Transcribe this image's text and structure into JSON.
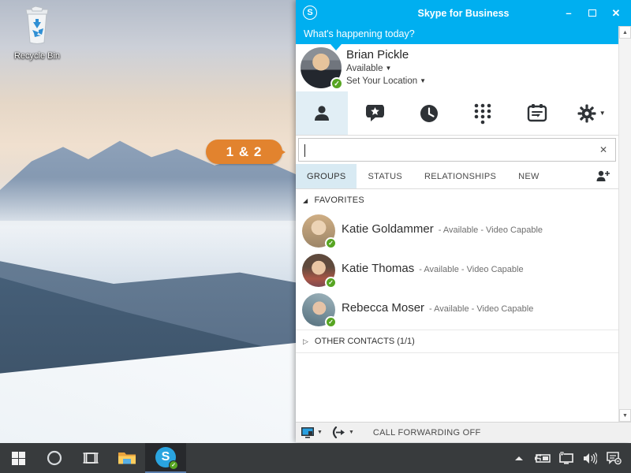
{
  "desktop": {
    "recycle_bin": {
      "label": "Recycle Bin"
    }
  },
  "callout": {
    "label": "1 & 2",
    "color": "#e2832e"
  },
  "skype": {
    "titlebar": {
      "logo_letter": "S",
      "title": "Skype for Business"
    },
    "note_bar": {
      "prompt": "What's happening today?"
    },
    "user": {
      "name": "Brian Pickle",
      "status": "Available",
      "location_prompt": "Set Your Location"
    },
    "search": {
      "value": ""
    },
    "tabs": {
      "items": [
        {
          "label": "GROUPS"
        },
        {
          "label": "STATUS"
        },
        {
          "label": "RELATIONSHIPS"
        },
        {
          "label": "NEW"
        }
      ],
      "active": "GROUPS"
    },
    "groups": {
      "favorites_label": "FAVORITES",
      "other_contacts_label": "OTHER CONTACTS (1/1)"
    },
    "contacts": [
      {
        "name": "Katie Goldammer",
        "meta": "- Available - Video Capable"
      },
      {
        "name": "Katie Thomas",
        "meta": "- Available - Video Capable"
      },
      {
        "name": "Rebecca Moser",
        "meta": "- Available - Video Capable"
      }
    ],
    "footer": {
      "call_forwarding_status": "CALL FORWARDING OFF"
    },
    "colors": {
      "accent_blue": "#00aff0",
      "presence_green": "#57a522",
      "tab_highlight": "#d8eaf3"
    }
  },
  "glyphs": {
    "minimize": "–",
    "close": "✕",
    "clear": "✕",
    "dropdown": "▼",
    "scroll_up": "▲",
    "scroll_down": "▼",
    "group_expanded": "◢",
    "group_collapsed": "▷",
    "check": "✓"
  }
}
